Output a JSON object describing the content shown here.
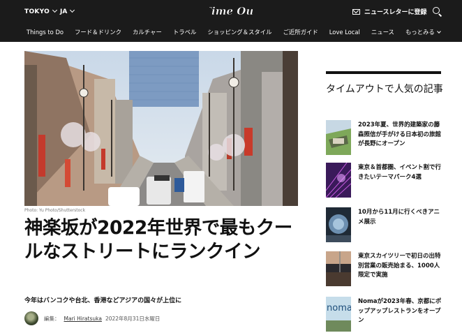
{
  "header": {
    "city": "TOKYO",
    "lang": "JA",
    "logo": "Time Out",
    "newsletter": "ニュースレターに登録",
    "icons": [
      "mail-icon",
      "search-icon"
    ]
  },
  "nav": {
    "items": [
      "Things to Do",
      "フード＆ドリンク",
      "カルチャー",
      "トラベル",
      "ショッピング＆スタイル",
      "ご近所ガイド",
      "Love Local",
      "ニュース",
      "もっとみる"
    ]
  },
  "article": {
    "photo_credit": "Photo: Yu Photo/Shutterstock",
    "title": "神楽坂が2022年世界で最もクールなストリートにランクイン",
    "subtitle": "今年はバンコクや台北、香港などアジアの国々が上位に",
    "edit_label": "編集：",
    "author": "Mari Hiratsuka",
    "date": "2022年8月31日水曜日"
  },
  "sidebar": {
    "title": "タイムアウトで人気の記事",
    "items": [
      {
        "text": "2023年夏、世界的建築家の藤森照信が手がける日本初の旅館が長野にオープン"
      },
      {
        "text": "東京＆首都圏、イベント割で行きたいテーマパーク4選"
      },
      {
        "text": "10月から11月に行くべきアニメ展示"
      },
      {
        "text": "東京スカイツリーで初日の出特別営業の販売始まる、1000人限定で実施"
      },
      {
        "text": "Nomaが2023年春、京都にポップアップレストランをオープン",
        "thumb_text": "noma"
      }
    ]
  },
  "colors": {
    "header_bg": "#1b1b1b",
    "text": "#111111"
  }
}
